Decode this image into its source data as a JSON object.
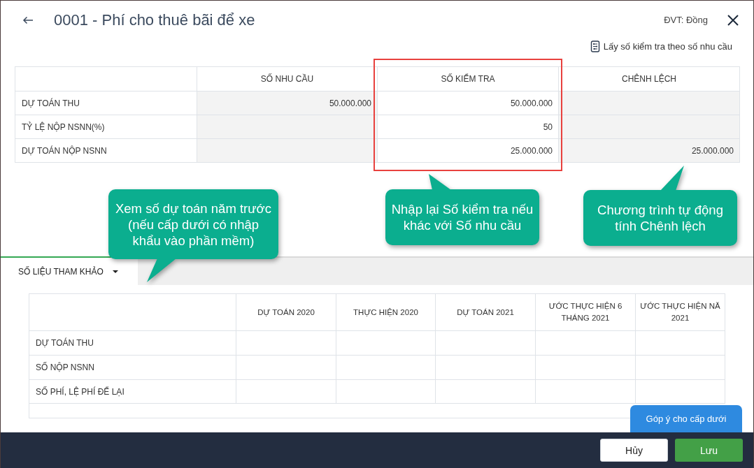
{
  "header": {
    "title": "0001 - Phí cho thuê bãi để xe",
    "unit": "ĐVT: Đồng"
  },
  "fill_action": {
    "label": "Lấy số kiểm tra theo số nhu cầu"
  },
  "main_table": {
    "columns": {
      "so_nhu_cau": {
        "label": "SỐ NHU CẦU",
        "editable": false,
        "highlighted": false
      },
      "so_kiem_tra": {
        "label": "SỐ KIỂM TRA",
        "editable": true,
        "highlighted": true
      },
      "chenh_lech": {
        "label": "CHÊNH LỆCH",
        "editable": false,
        "highlighted": false
      }
    },
    "rows": [
      {
        "label": "DỰ TOÁN THU",
        "so_nhu_cau": "50.000.000",
        "so_kiem_tra": "50.000.000"
      },
      {
        "label": "TỶ LỆ NỘP NSNN(%)",
        "so_kiem_tra": "50"
      },
      {
        "label": "DỰ TOÁN NỘP NSNN",
        "so_kiem_tra": "25.000.000",
        "chenh_lech": "25.000.000"
      }
    ]
  },
  "callouts": [
    {
      "text": "Xem số dự toán năm trước (nếu cấp dưới có nhập khẩu vào phần mềm)"
    },
    {
      "text": "Nhập lại Số kiểm tra nếu khác với Số nhu cầu"
    },
    {
      "text": "Chương trình tự động tính Chênh lệch"
    }
  ],
  "tabs": [
    {
      "label": "SỐ LIỆU THAM KHẢO",
      "selected": true
    }
  ],
  "reference_table": {
    "columns": [
      "DỰ TOÁN 2020",
      "THỰC HIỆN 2020",
      "DỰ TOÁN 2021",
      "ƯỚC THỰC HIỆN 6 THÁNG 2021",
      "ƯỚC THỰC HIỆN NĂ\n2021"
    ],
    "rows": [
      {
        "label": "DỰ TOÁN THU"
      },
      {
        "label": "SỐ NỘP NSNN"
      },
      {
        "label": "SỐ PHÍ, LỆ PHÍ ĐỂ LẠI"
      }
    ]
  },
  "feedback_button": {
    "label": "Góp ý cho cấp dưới"
  },
  "footer": {
    "buttons": [
      {
        "label": "Hủy",
        "kind": "secondary"
      },
      {
        "label": "Lưu",
        "kind": "primary"
      }
    ]
  }
}
